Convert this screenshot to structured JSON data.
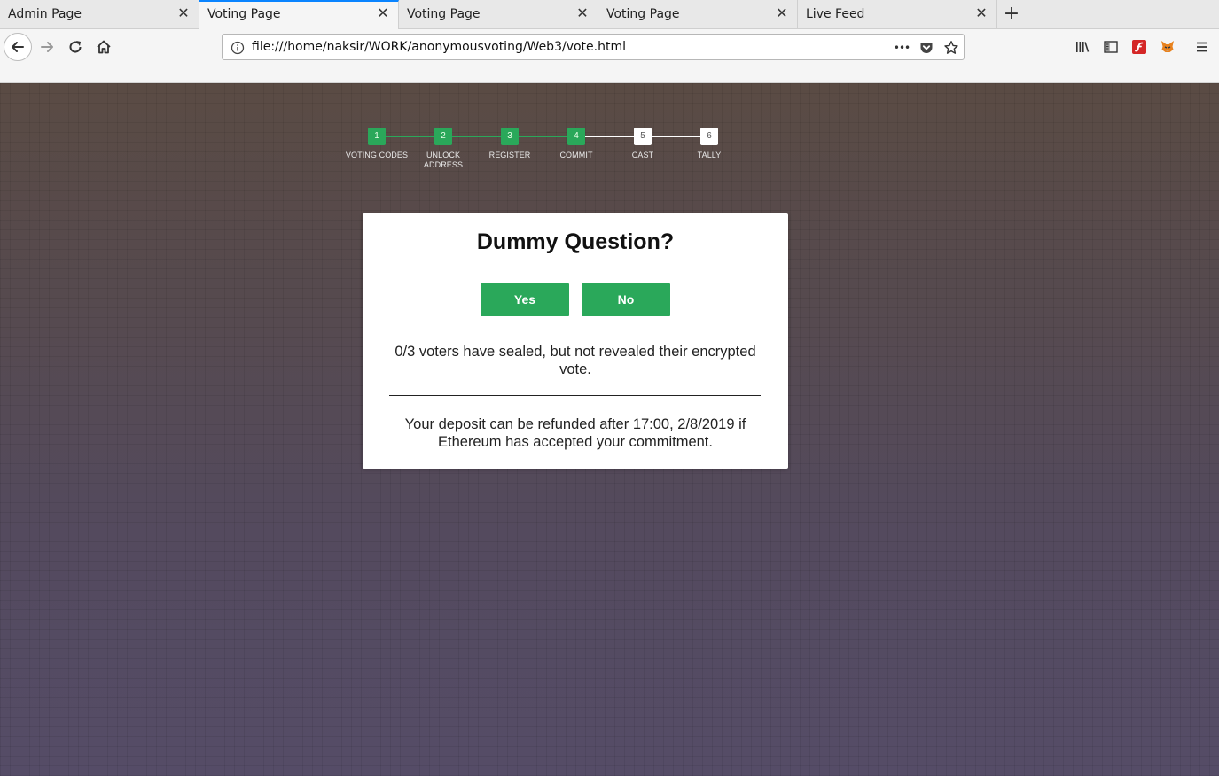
{
  "browser": {
    "tabs": [
      {
        "title": "Admin Page",
        "active": false
      },
      {
        "title": "Voting Page",
        "active": true
      },
      {
        "title": "Voting Page",
        "active": false
      },
      {
        "title": "Voting Page",
        "active": false
      },
      {
        "title": "Live Feed",
        "active": false
      }
    ],
    "close_glyph": "✕",
    "new_tab_glyph": "+",
    "url": "file:///home/naksir/WORK/anonymousvoting/Web3/vote.html",
    "page_actions_glyph": "•••",
    "icons": {
      "back": "back-arrow-icon",
      "forward": "forward-arrow-icon",
      "reload": "reload-icon",
      "home": "home-icon",
      "info": "info-icon",
      "pocket": "pocket-icon",
      "bookmark": "star-icon",
      "library": "library-icon",
      "sidebar": "sidebar-icon",
      "flash": "flash-icon",
      "metamask": "metamask-fox-icon",
      "menu": "hamburger-menu-icon"
    }
  },
  "stepper": {
    "steps": [
      {
        "num": "1",
        "label": "VOTING CODES",
        "done": true
      },
      {
        "num": "2",
        "label": "UNLOCK ADDRESS",
        "done": true
      },
      {
        "num": "3",
        "label": "REGISTER",
        "done": true
      },
      {
        "num": "4",
        "label": "COMMIT",
        "done": true
      },
      {
        "num": "5",
        "label": "CAST",
        "done": false
      },
      {
        "num": "6",
        "label": "TALLY",
        "done": false
      }
    ],
    "done_color": "#2aa85a",
    "todo_color": "#ffffff"
  },
  "card": {
    "question": "Dummy Question?",
    "yes_label": "Yes",
    "no_label": "No",
    "status": "0/3 voters have sealed, but not revealed their encrypted vote.",
    "deposit_note": "Your deposit can be refunded after 17:00, 2/8/2019 if Ethereum has accepted your commitment."
  }
}
